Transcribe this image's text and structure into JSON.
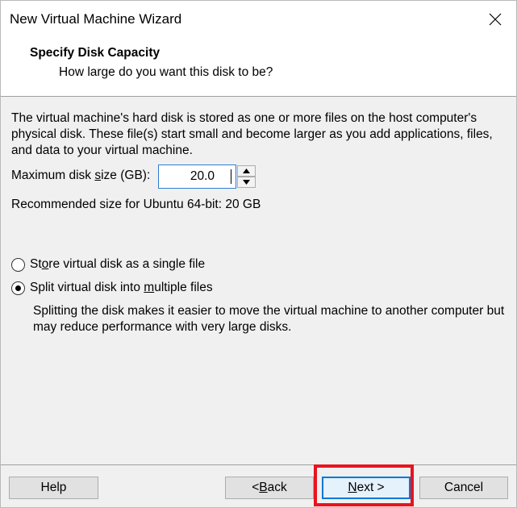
{
  "window": {
    "title": "New Virtual Machine Wizard"
  },
  "header": {
    "title": "Specify Disk Capacity",
    "subtitle": "How large do you want this disk to be?"
  },
  "content": {
    "description": "The virtual machine's hard disk is stored as one or more files on the host computer's physical disk. These file(s) start small and become larger as you add applications, files, and data to your virtual machine.",
    "max_size_label_pre": "Maximum disk ",
    "max_size_label_mnemonic": "s",
    "max_size_label_post": "ize (GB):",
    "max_size_value": "20.0",
    "recommended": "Recommended size for Ubuntu 64-bit: 20 GB",
    "options": [
      {
        "pre": "St",
        "mnemonic": "o",
        "post": "re virtual disk as a single file",
        "checked": false
      },
      {
        "pre": "Split virtual disk into ",
        "mnemonic": "m",
        "post": "ultiple files",
        "checked": true
      }
    ],
    "split_note": "Splitting the disk makes it easier to move the virtual machine to another computer but may reduce performance with very large disks."
  },
  "footer": {
    "help": "Help",
    "back_mnemonic": "B",
    "back_post": "ack",
    "back_pre": "< ",
    "next_mnemonic": "N",
    "next_post": "ext >",
    "cancel": "Cancel"
  },
  "colors": {
    "highlight": "#e8131f",
    "focus": "#0078d7"
  }
}
